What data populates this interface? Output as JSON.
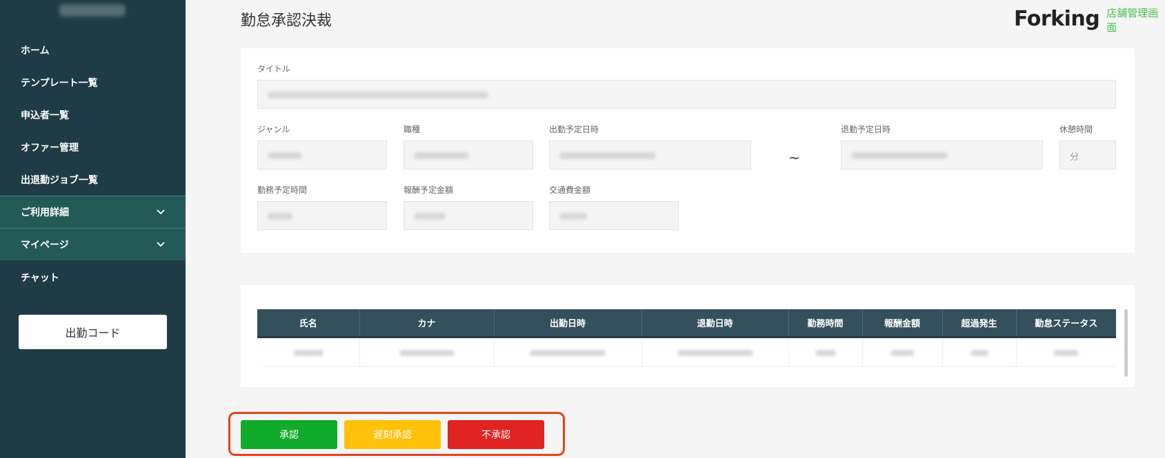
{
  "sidebar": {
    "items": [
      {
        "label": "ホーム"
      },
      {
        "label": "テンプレート一覧"
      },
      {
        "label": "申込者一覧"
      },
      {
        "label": "オファー管理"
      },
      {
        "label": "出退勤ジョブ一覧"
      },
      {
        "label": "ご利用詳細",
        "expandable": true
      },
      {
        "label": "マイページ",
        "expandable": true
      },
      {
        "label": "チャット"
      }
    ],
    "code_button": "出勤コード"
  },
  "header": {
    "title": "勤怠承認決裁",
    "logo_word": "Forking",
    "logo_sub": "店舗管理画面"
  },
  "form": {
    "title_label": "タイトル",
    "genre_label": "ジャンル",
    "occupation_label": "職種",
    "start_label": "出勤予定日時",
    "range_separator": "~",
    "end_label": "退勤予定日時",
    "break_label": "休憩時間",
    "break_unit": "分",
    "work_hours_label": "勤務予定時間",
    "reward_label": "報酬予定金額",
    "transport_label": "交通費金額"
  },
  "table": {
    "columns": [
      "氏名",
      "カナ",
      "出勤日時",
      "退勤日時",
      "勤務時間",
      "報酬金額",
      "超過発生",
      "勤怠ステータス"
    ]
  },
  "actions": {
    "approve": "承認",
    "late_approve": "遅刻承認",
    "reject": "不承認"
  },
  "colors": {
    "sidebar_bg": "#1f3b46",
    "sidebar_expand_bg": "#245a56",
    "approve": "#10ab2a",
    "late_approve": "#ffc10a",
    "reject": "#e02323",
    "highlight_frame": "#e8401c",
    "brand_green": "#4cc04c"
  }
}
